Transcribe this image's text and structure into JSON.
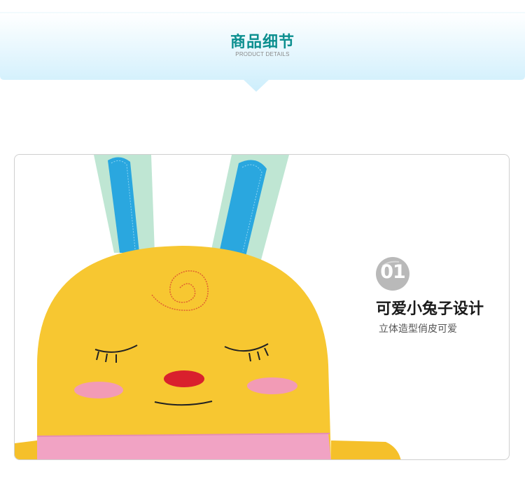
{
  "header": {
    "title": "商品细节",
    "subtitle": "PRODUCT DETAILS",
    "colors": {
      "gradient_top": "#ffffff",
      "gradient_bottom": "#cdeefc",
      "title": "#0c8f8f"
    }
  },
  "feature": {
    "number": "01",
    "title": "可爱小兔子设计",
    "description": "立体造型俏皮可爱"
  },
  "product_photo": {
    "subject": "yellow bunny pillow with blue ears",
    "colors": {
      "body": "#f7c731",
      "ear_outer": "#bfe6d3",
      "ear_inner": "#2aa7df",
      "cheek": "#f29bb6",
      "nose": "#d9202d",
      "band": "#f1a3c4"
    }
  }
}
